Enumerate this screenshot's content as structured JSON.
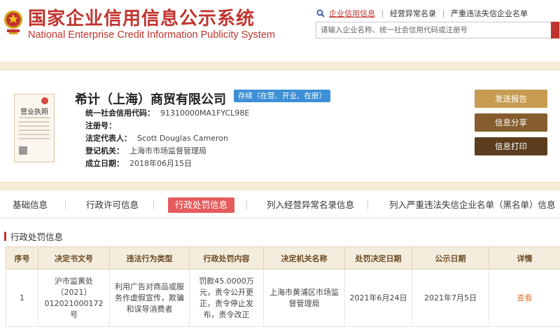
{
  "header": {
    "title_cn": "国家企业信用信息公示系统",
    "title_en": "National Enterprise Credit Information Publicity System"
  },
  "topnav": {
    "items": [
      "企业信用信息",
      "经营异常名录",
      "严重违法失信企业名单"
    ]
  },
  "search": {
    "placeholder": "请输入企业名称、统一社会信用代码或注册号"
  },
  "company": {
    "name": "希计（上海）商贸有限公司",
    "status": "存续（在营、开业、在册）",
    "license_label": "营业执照",
    "fields": [
      {
        "label": "统一社会信用代码：",
        "value": "91310000MA1FYCL98E"
      },
      {
        "label": "注册号：",
        "value": ""
      },
      {
        "label": "法定代表人：",
        "value": "Scott Douglas Cameron"
      },
      {
        "label": "登记机关：",
        "value": "上海市市场监督管理局"
      },
      {
        "label": "成立日期：",
        "value": "2018年06月15日"
      }
    ]
  },
  "actions": {
    "report": "发送报告",
    "share": "信息分享",
    "print": "信息打印"
  },
  "tabs": [
    "基础信息",
    "行政许可信息",
    "行政处罚信息",
    "列入经营异常名录信息",
    "列入严重违法失信企业名单（黑名单）信息"
  ],
  "section": {
    "title": "行政处罚信息"
  },
  "table": {
    "headers": [
      "序号",
      "决定书文号",
      "违法行为类型",
      "行政处罚内容",
      "决定机关名称",
      "处罚决定日期",
      "公示日期",
      "详情"
    ],
    "rows": [
      {
        "index": "1",
        "doc_no": "沪市监黄处〔2021〕012021000172号",
        "violation": "利用广告对商品或服务作虚假宣传，欺骗和误导消费者",
        "penalty": "罚款45.0000万元，责令公开更正，责令停止发布，责令改正",
        "authority": "上海市黄浦区市场监督管理局",
        "decision_date": "2021年6月24日",
        "publish_date": "2021年7月5日",
        "detail": "查看"
      }
    ]
  },
  "colors": {
    "brand_red": "#c0342e",
    "badge_blue": "#3d8fd6",
    "tab_active": "#e55b5b",
    "btn_gold": "#c69b52",
    "btn_brown": "#865d2e",
    "btn_dark": "#5c3d1d",
    "link_orange": "#e0763c"
  }
}
